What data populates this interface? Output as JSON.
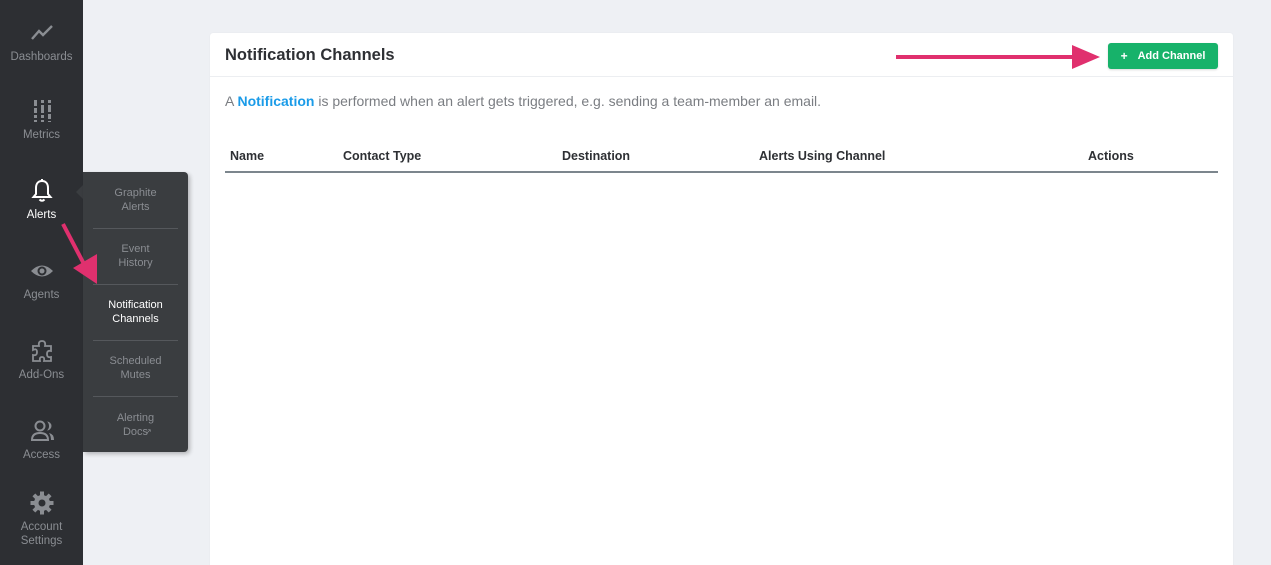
{
  "sidebar": {
    "items": [
      {
        "label": "Dashboards",
        "icon": "trend-line-icon",
        "active": false
      },
      {
        "label": "Metrics",
        "icon": "metrics-bars-icon",
        "active": false
      },
      {
        "label": "Alerts",
        "icon": "bell-icon",
        "active": true
      },
      {
        "label": "Agents",
        "icon": "eye-icon",
        "active": false
      },
      {
        "label": "Add-Ons",
        "icon": "puzzle-piece-icon",
        "active": false
      },
      {
        "label": "Access",
        "icon": "users-icon",
        "active": false
      },
      {
        "label": "Account Settings",
        "icon": "gear-icon",
        "active": false
      }
    ]
  },
  "submenu": {
    "items": [
      {
        "label": "Graphite Alerts",
        "active": false
      },
      {
        "label": "Event History",
        "active": false
      },
      {
        "label": "Notification Channels",
        "active": true
      },
      {
        "label": "Scheduled Mutes",
        "active": false
      },
      {
        "label": "Alerting Docs",
        "active": false,
        "external": true,
        "external_icon": "↗"
      }
    ]
  },
  "main": {
    "title": "Notification Channels",
    "add_button": {
      "icon": "+",
      "label": "Add Channel"
    },
    "description": {
      "prefix": "A",
      "link": "Notification",
      "suffix": "is performed when an alert gets triggered, e.g. sending a team-member an email."
    },
    "table": {
      "columns": [
        "Name",
        "Contact Type",
        "Destination",
        "Alerts Using Channel",
        "Actions"
      ],
      "rows": []
    }
  },
  "colors": {
    "accent_green": "#17b26a",
    "link_blue": "#1a9be8",
    "annotation_arrow": "#e0306e",
    "sidebar_bg": "#2d2f33"
  }
}
